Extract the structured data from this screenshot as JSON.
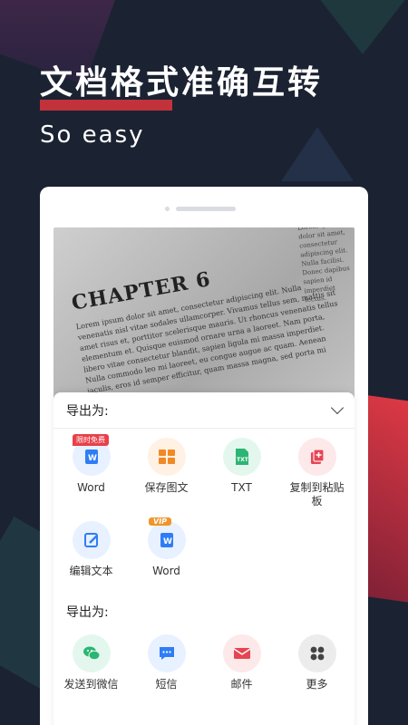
{
  "hero": {
    "title": "文档格式准确互转",
    "subtitle": "So easy"
  },
  "document": {
    "chapter": "CHAPTER 6",
    "body": "Lorem ipsum dolor sit amet, consectetur adipiscing elit. Nulla venenatis nisl vitae sodales ullamcorper. Vivamus tellus sem, mattis sit amet risus et, porttitor scelerisque mauris. Ut rhoncus venenatis tellus elementum et. Quisque euismod ornare urna a laoreet. Nam porta, libero vitae consectetur blandit, sapien ligula mi massa imperdiet. Nulla commodo leo mi laoreet, eu congue augue ac quam. Aenean iaculis, eros id semper efficitur, quam massa magna, sed porta mi purus eu.",
    "side": "Lorem ipsum dolor sit amet, consectetur adipiscing elit. Nulla facilisi. Donec dapibus sapien id imperdiet lectus."
  },
  "export_section": {
    "title": "导出为:",
    "items": [
      {
        "label": "Word",
        "badge": "限时免费",
        "icon": "word-doc-icon",
        "color": "#2f7df6",
        "bg": "#e8f1ff"
      },
      {
        "label": "保存图文",
        "icon": "image-text-icon",
        "color": "#f08a24",
        "bg": "#fff1e3"
      },
      {
        "label": "TXT",
        "icon": "txt-file-icon",
        "color": "#2bb673",
        "bg": "#e4f7ee"
      },
      {
        "label": "复制到粘贴板",
        "icon": "clipboard-copy-icon",
        "color": "#e64552",
        "bg": "#fde8ea"
      },
      {
        "label": "编辑文本",
        "icon": "edit-text-icon",
        "color": "#2f7df6",
        "bg": "#e8f1ff"
      },
      {
        "label": "Word",
        "badge": "VIP",
        "icon": "word-doc-icon",
        "color": "#2f7df6",
        "bg": "#e8f1ff"
      }
    ]
  },
  "share_section": {
    "title": "导出为:",
    "items": [
      {
        "label": "发送到微信",
        "icon": "wechat-icon",
        "color": "#2bb673",
        "bg": "#e4f7ee"
      },
      {
        "label": "短信",
        "icon": "sms-icon",
        "color": "#2f7df6",
        "bg": "#e8f1ff"
      },
      {
        "label": "邮件",
        "icon": "mail-icon",
        "color": "#e64552",
        "bg": "#fde8ea"
      },
      {
        "label": "更多",
        "icon": "more-grid-icon",
        "color": "#444444",
        "bg": "#ececec"
      }
    ]
  }
}
